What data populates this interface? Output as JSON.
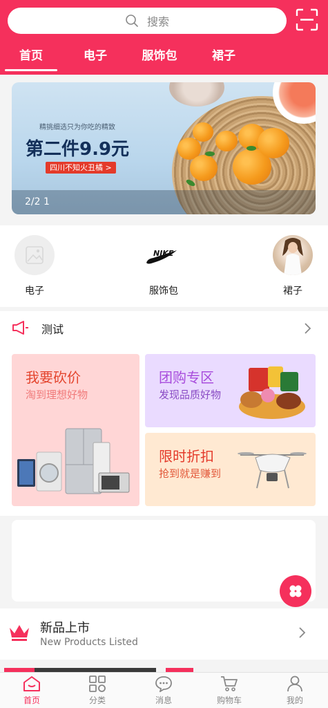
{
  "search": {
    "placeholder": "搜索"
  },
  "tabs": [
    {
      "label": "首页",
      "active": true
    },
    {
      "label": "电子"
    },
    {
      "label": "服饰包"
    },
    {
      "label": "裙子"
    }
  ],
  "banner": {
    "subtitle": "精挑细选只为你吃的精致",
    "title": "第二件9.9元",
    "tag": "四川不知火丑橘 >",
    "pager": "2/2 1"
  },
  "categories": [
    {
      "label": "电子",
      "icon": "image-placeholder-icon"
    },
    {
      "label": "服饰包",
      "icon": "nike-logo"
    },
    {
      "label": "裙子",
      "icon": "girl-avatar"
    }
  ],
  "notice": {
    "text": "测试",
    "icon": "megaphone-icon"
  },
  "promos": [
    {
      "title": "我要砍价",
      "subtitle": "淘到理想好物",
      "bg": "#ffd6d6",
      "title_color": "#e4452e",
      "sub_color": "#f07a7a"
    },
    {
      "title": "团购专区",
      "subtitle": "发现品质好物",
      "bg": "#eadbff",
      "title_color": "#a84ddc",
      "sub_color": "#8a4cc4"
    },
    {
      "title": "限时折扣",
      "subtitle": "抢到就是赚到",
      "bg": "#ffe9d2",
      "title_color": "#e43a2a",
      "sub_color": "#e2583a"
    }
  ],
  "new_products": {
    "title": "新品上市",
    "subtitle": "New Products Listed"
  },
  "bottom_nav": [
    {
      "label": "首页",
      "icon": "home-icon",
      "active": true
    },
    {
      "label": "分类",
      "icon": "category-icon"
    },
    {
      "label": "消息",
      "icon": "message-icon"
    },
    {
      "label": "购物车",
      "icon": "cart-icon"
    },
    {
      "label": "我的",
      "icon": "user-icon"
    }
  ],
  "colors": {
    "brand": "#f5305c"
  }
}
